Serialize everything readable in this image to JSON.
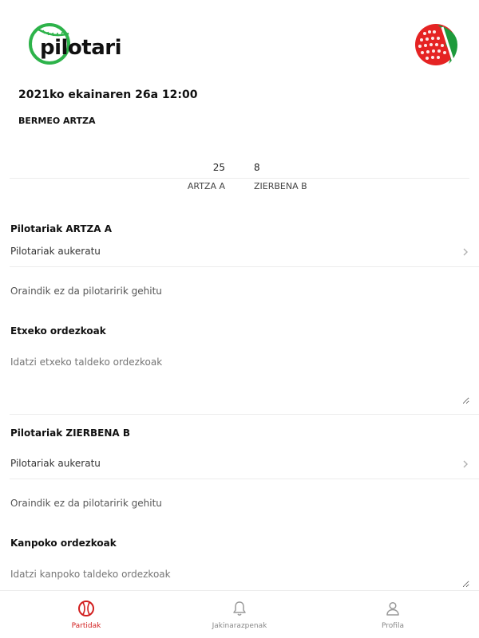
{
  "header": {
    "logo_text": "pilotari",
    "logo_icon": "pilotari-logo-icon",
    "badge_icon": "ikurrina-ball-icon"
  },
  "match": {
    "datetime": "2021ko ekainaren 26a 12:00",
    "venue": "BERMEO ARTZA"
  },
  "score": {
    "home_points": "25",
    "away_points": "8",
    "home_team": "ARTZA A",
    "away_team": "ZIERBENA B"
  },
  "home_section": {
    "title": "Pilotariak ARTZA A",
    "select_label": "Pilotariak aukeratu",
    "empty_message": "Oraindik ez da pilotaririk gehitu",
    "subs_title": "Etxeko ordezkoak",
    "subs_placeholder": "Idatzi etxeko taldeko ordezkoak"
  },
  "away_section": {
    "title": "Pilotariak ZIERBENA B",
    "select_label": "Pilotariak aukeratu",
    "empty_message": "Oraindik ez da pilotaririk gehitu",
    "subs_title": "Kanpoko ordezkoak",
    "subs_placeholder": "Idatzi kanpoko taldeko ordezkoak"
  },
  "bottom_nav": {
    "items": [
      {
        "label": "Partidak",
        "icon": "ball-icon",
        "active": true
      },
      {
        "label": "Jakinarazpenak",
        "icon": "bell-icon",
        "active": false
      },
      {
        "label": "Profila",
        "icon": "user-icon",
        "active": false
      }
    ]
  },
  "colors": {
    "accent": "#d21f1f",
    "logo_green": "#2db34a",
    "text": "#111111",
    "muted": "#888888",
    "divider": "#ececec"
  }
}
